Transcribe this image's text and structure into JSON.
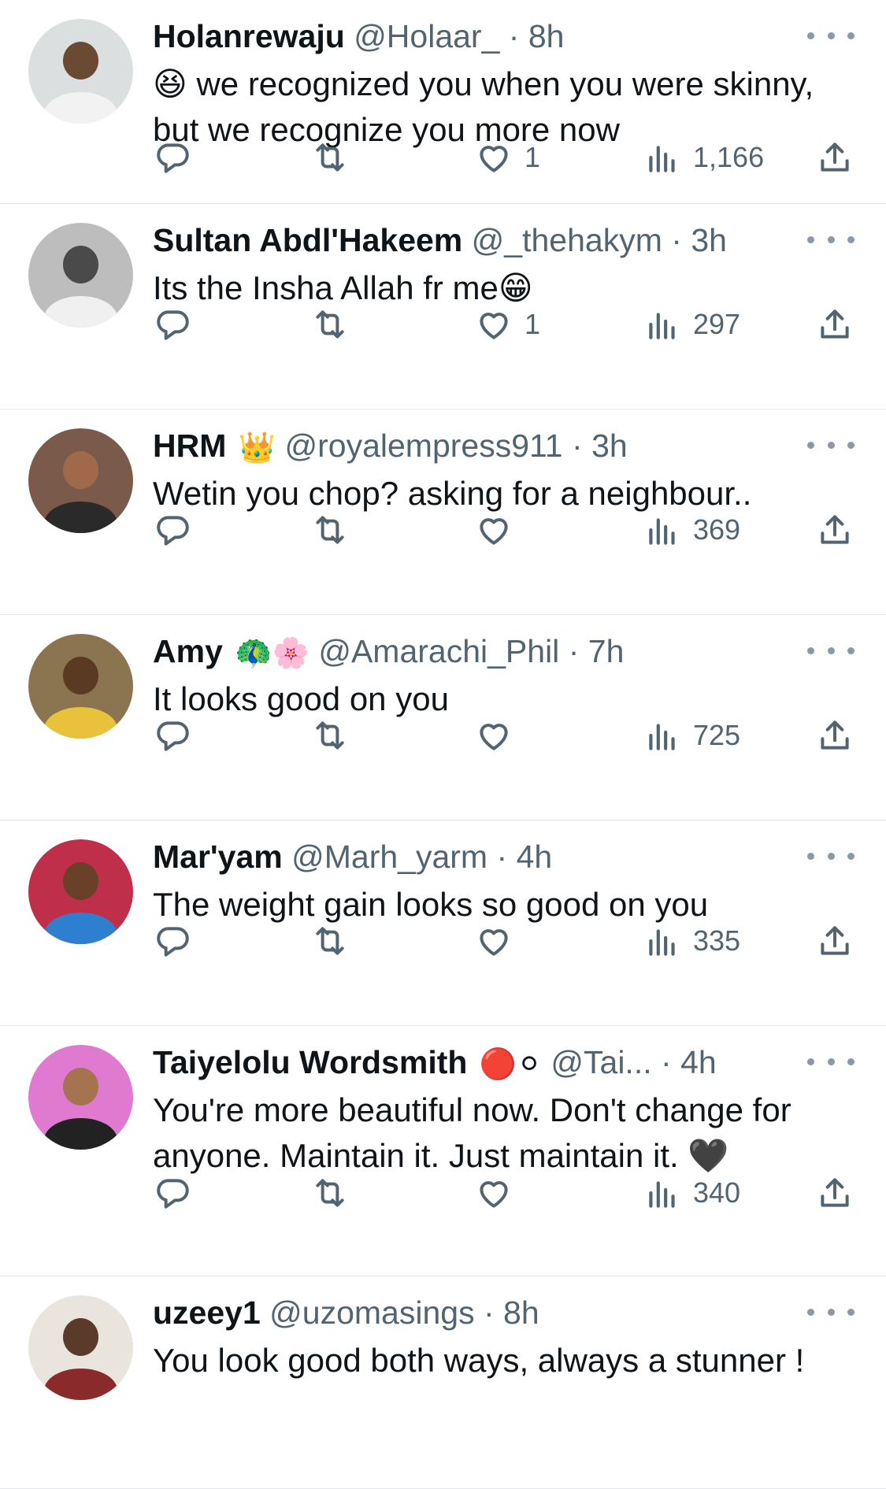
{
  "colors": {
    "text": "#0f1419",
    "secondary": "#536471",
    "divider": "#e3e6e8",
    "background": "#ffffff"
  },
  "icons": {
    "reply": "reply-icon",
    "retweet": "retweet-icon",
    "like": "heart-icon",
    "views": "views-icon",
    "share": "share-icon",
    "more": "more-icon"
  },
  "tweets": [
    {
      "name": "Holanrewaju",
      "name_emoji": "",
      "handle": "@Holaar_",
      "dot": "·",
      "time": "8h",
      "lead_emoji": "😆",
      "text": " we recognized you when you were skinny, but we recognize you more now",
      "likes": "1",
      "views": "1,166",
      "avatar": {
        "bg": "#dcdfdf",
        "face": "#6b4a33",
        "torso": "#f2f2f2"
      }
    },
    {
      "name": "Sultan Abdl'Hakeem",
      "name_emoji": "",
      "handle": "@_thehakym",
      "dot": "·",
      "time": "3h",
      "lead_emoji": "",
      "text": "Its the Insha Allah fr me😁",
      "likes": "1",
      "views": "297",
      "avatar": {
        "bg": "#bdbdbd",
        "face": "#4a4a4a",
        "torso": "#f0f0f0"
      }
    },
    {
      "name": "HRM",
      "name_emoji": "👑",
      "handle": "@royalempress911",
      "dot": "·",
      "time": "3h",
      "lead_emoji": "",
      "text": "Wetin you chop? asking for a neighbour..",
      "likes": "",
      "views": "369",
      "avatar": {
        "bg": "#7a5a4a",
        "face": "#a06a4a",
        "torso": "#2a2a2a"
      }
    },
    {
      "name": "Amy",
      "name_emoji": "🦚🌸",
      "handle": "@Amarachi_Phil",
      "dot": "·",
      "time": "7h",
      "lead_emoji": "",
      "text": "It looks good on you",
      "likes": "",
      "views": "725",
      "avatar": {
        "bg": "#8a7550",
        "face": "#5a3a22",
        "torso": "#e8c23a"
      }
    },
    {
      "name": "Mar'yam",
      "name_emoji": "",
      "handle": "@Marh_yarm",
      "dot": "·",
      "time": "4h",
      "lead_emoji": "",
      "text": "The weight gain looks so good on you",
      "likes": "",
      "views": "335",
      "avatar": {
        "bg": "#c02f4a",
        "face": "#6a4028",
        "torso": "#2f7fd0"
      }
    },
    {
      "name": "Taiyelolu Wordsmith",
      "name_emoji": "🔴⚪",
      "handle": "@Tai...",
      "dot": "·",
      "time": "4h",
      "lead_emoji": "",
      "text": "You're more beautiful now. Don't change for anyone. Maintain it. Just maintain it. 🖤",
      "likes": "",
      "views": "340",
      "avatar": {
        "bg": "#e07ad0",
        "face": "#a5734f",
        "torso": "#222222"
      }
    },
    {
      "name": "uzeey1",
      "name_emoji": "",
      "handle": "@uzomasings",
      "dot": "·",
      "time": "8h",
      "lead_emoji": "",
      "text": "You look good both ways, always a stunner !",
      "likes": "",
      "views": "",
      "avatar": {
        "bg": "#e9e4dc",
        "face": "#5a3a28",
        "torso": "#8a2a2a"
      }
    }
  ]
}
